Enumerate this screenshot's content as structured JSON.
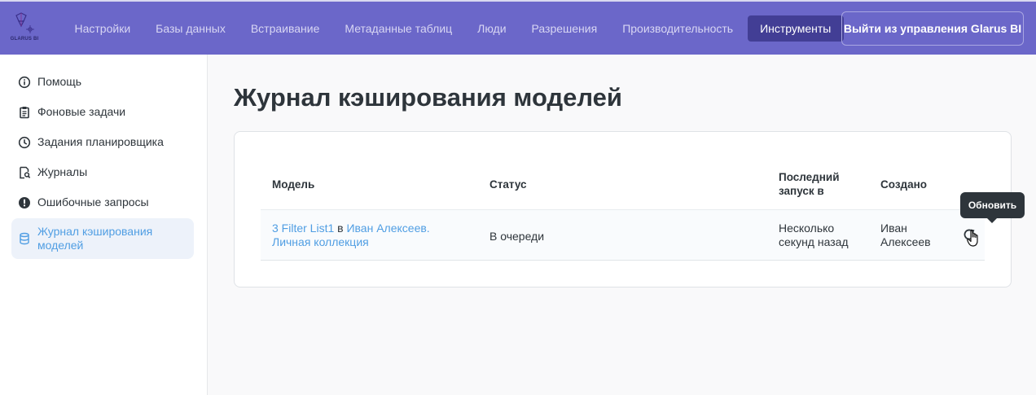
{
  "logo": {
    "text": "GLARUS BI"
  },
  "nav": {
    "items": [
      "Настройки",
      "Базы данных",
      "Встраивание",
      "Метаданные таблиц",
      "Люди",
      "Разрешения",
      "Производительность"
    ],
    "active": "Инструменты",
    "exit_label": "Выйти из управления Glarus BI"
  },
  "sidebar": {
    "items": [
      {
        "label": "Помощь",
        "icon": "info-icon"
      },
      {
        "label": "Фоновые задачи",
        "icon": "clipboard-icon"
      },
      {
        "label": "Задания планировщика",
        "icon": "clock-icon"
      },
      {
        "label": "Журналы",
        "icon": "log-search-icon"
      },
      {
        "label": "Ошибочные запросы",
        "icon": "warning-icon"
      },
      {
        "label": "Журнал кэширования моделей",
        "icon": "database-icon"
      }
    ]
  },
  "page": {
    "title": "Журнал кэширования моделей"
  },
  "table": {
    "headers": {
      "model": "Модель",
      "status": "Статус",
      "last_run": "Последний запуск в",
      "created": "Создано"
    },
    "rows": [
      {
        "model": "3 Filter List1",
        "joiner": "в",
        "collection": "Иван Алексеев. Личная коллекция",
        "status": "В очереди",
        "last_run": "Несколько секунд назад",
        "created": "Иван Алексеев"
      }
    ]
  },
  "tooltip": {
    "label": "Обновить"
  },
  "colors": {
    "header_bg": "#6b67c9",
    "active_nav": "#423e95",
    "link": "#509ee3",
    "tooltip": "#2e353b"
  }
}
